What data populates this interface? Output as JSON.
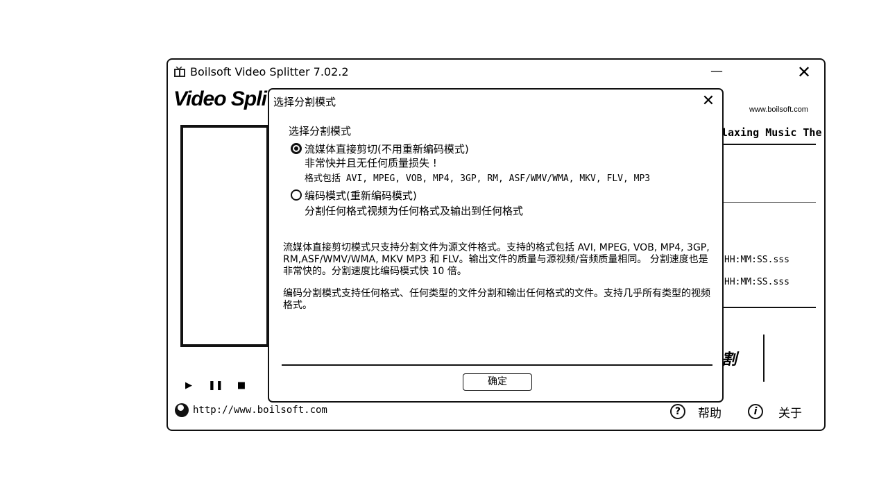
{
  "window": {
    "title": "Boilsoft Video Splitter 7.02.2",
    "minimize_glyph": "—",
    "close_glyph": "✕"
  },
  "main": {
    "logo_text": "Video Spli",
    "site_text": "www.boilsoft.com",
    "file_name": "laxing Music The",
    "time_start": "HH:MM:SS.sss",
    "time_end": "HH:MM:SS.sss",
    "split_button_partial": "割",
    "playback": {
      "play": "▶",
      "pause": "❚❚",
      "stop": "■"
    }
  },
  "footer": {
    "url": "http://www.boilsoft.com",
    "help_label": "帮助",
    "help_glyph": "?",
    "about_label": "关于",
    "about_glyph": "i"
  },
  "dialog": {
    "title": "选择分割模式",
    "close_glyph": "✕",
    "group_label": "选择分割模式",
    "options": [
      {
        "label": "流媒体直接剪切(不用重新编码模式)",
        "selected": true,
        "line1": "非常快并且无任何质量损失 !",
        "line2": "格式包括 AVI, MPEG, VOB, MP4, 3GP, RM, ASF/WMV/WMA, MKV, FLV, MP3"
      },
      {
        "label": "编码模式(重新编码模式)",
        "selected": false,
        "line1": "分割任何格式视频为任何格式及输出到任何格式"
      }
    ],
    "description_1": "流媒体直接剪切模式只支持分割文件为源文件格式。支持的格式包括 AVI, MPEG, VOB, MP4, 3GP, RM,ASF/WMV/WMA, MKV MP3 和 FLV。输出文件的质量与源视频/音频质量相同。 分割速度也是非常快的。分割速度比编码模式快 10 倍。",
    "description_2": "编码分割模式支持任何格式、任何类型的文件分割和输出任何格式的文件。支持几乎所有类型的视频格式。",
    "ok_label": "确定"
  }
}
